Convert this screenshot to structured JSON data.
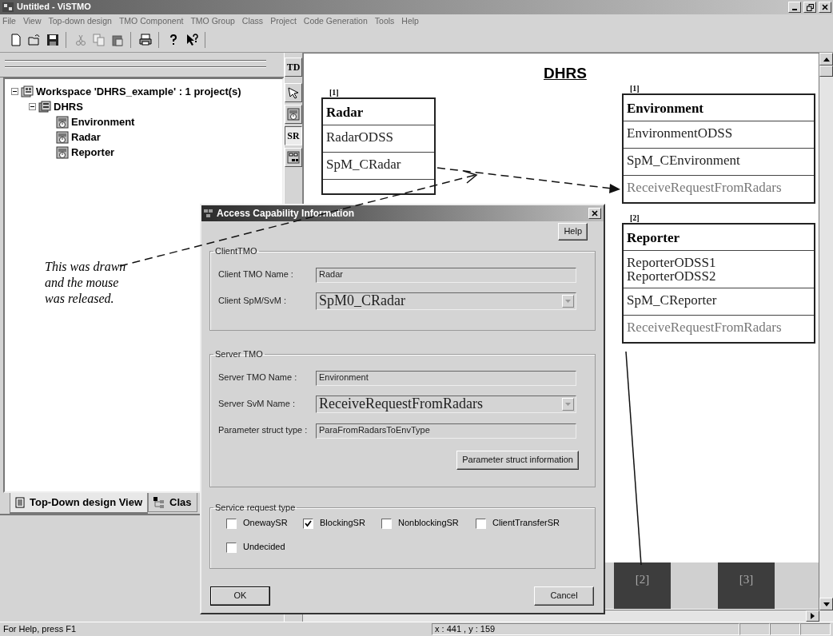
{
  "window": {
    "title": "Untitled - ViSTMO"
  },
  "menu": [
    "File",
    "View",
    "Top-down design",
    "TMO Component",
    "TMO Group",
    "Class",
    "Project",
    "Code Generation",
    "Tools",
    "Help"
  ],
  "workspace_tree": {
    "kind": "workspace",
    "label": "Workspace 'DHRS_example' : 1 project(s)",
    "expanded": true,
    "children": [
      {
        "kind": "project",
        "label": "DHRS",
        "expanded": true,
        "children": [
          {
            "kind": "tmo",
            "label": "Environment"
          },
          {
            "kind": "tmo",
            "label": "Radar"
          },
          {
            "kind": "tmo",
            "label": "Reporter"
          }
        ]
      }
    ]
  },
  "annotation": " This was drawn and the mouse was released.",
  "pane_tabs": [
    {
      "label": "Top-Down design View",
      "selected": true
    },
    {
      "label": "Clas",
      "selected": false
    }
  ],
  "palette": [
    {
      "kind": "text",
      "label": "TD",
      "selected": false
    },
    {
      "kind": "pointer",
      "selected": false
    },
    {
      "kind": "tmo",
      "selected": false
    },
    {
      "kind": "text",
      "label": "SR",
      "selected": true
    },
    {
      "kind": "group",
      "selected": false
    }
  ],
  "diagram": {
    "title": "DHRS",
    "nodes": [
      {
        "tag": "[1]",
        "name": "Radar",
        "odss": [
          "RadarODSS"
        ],
        "spm": [
          "SpM_CRadar"
        ]
      },
      {
        "tag": "[1]",
        "name": "Environment",
        "odss": [
          "EnvironmentODSS"
        ],
        "spm": [
          "SpM_CEnvironment"
        ],
        "svm": [
          "ReceiveRequestFromRadars"
        ]
      },
      {
        "tag": "[2]",
        "name": "Reporter",
        "odss": [
          "ReporterODSS1",
          "ReporterODSS2"
        ],
        "spm": [
          "SpM_CReporter"
        ],
        "svm": [
          "ReceiveRequestFromRadars"
        ]
      }
    ],
    "tiles": [
      "[2]",
      "[3]"
    ]
  },
  "dialog": {
    "title": "Access Capability Information",
    "help": "Help",
    "groups": [
      {
        "title": "ClientTMO",
        "fields": [
          {
            "kind": "text",
            "label": "Client TMO Name :",
            "value": "Radar"
          },
          {
            "kind": "combo",
            "label": "Client SpM/SvM :",
            "value": "SpM0_CRadar"
          }
        ]
      },
      {
        "title": "Server TMO",
        "fields": [
          {
            "kind": "text",
            "label": "Server TMO Name :",
            "value": "Environment"
          },
          {
            "kind": "combo",
            "label": "Server SvM Name :",
            "value": "ReceiveRequestFromRadars"
          },
          {
            "kind": "text",
            "label": "Parameter struct type :",
            "value": "ParaFromRadarsToEnvType"
          }
        ],
        "button": "Parameter struct information"
      }
    ],
    "service_request": {
      "title": "Service request type",
      "options": [
        {
          "label": "OnewaySR",
          "checked": false
        },
        {
          "label": "BlockingSR",
          "checked": true
        },
        {
          "label": "NonblockingSR",
          "checked": false
        },
        {
          "label": "ClientTransferSR",
          "checked": false
        },
        {
          "label": "Undecided",
          "checked": false
        }
      ]
    },
    "ok": "OK",
    "cancel": "Cancel"
  },
  "status_bar": [
    "For Help, press F1",
    "x : 441 , y : 159"
  ]
}
